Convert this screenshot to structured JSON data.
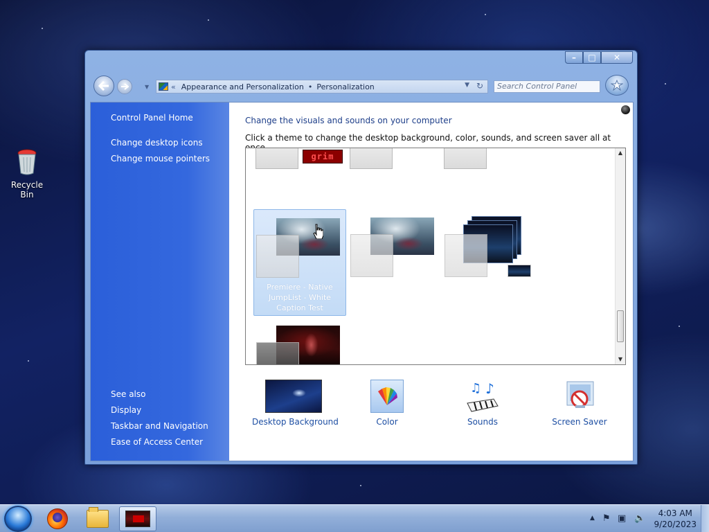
{
  "desktop": {
    "recycle_bin_label": "Recycle Bin"
  },
  "window": {
    "caption_buttons": {
      "minimize": "–",
      "maximize": "□",
      "close": "✕"
    },
    "address": {
      "chevron": "«",
      "crumb1": "Appearance and Personalization",
      "separator": "•",
      "crumb2": "Personalization"
    },
    "search": {
      "placeholder": "Search Control Panel"
    }
  },
  "sidebar": {
    "top_links": [
      "Control Panel Home",
      "Change desktop icons",
      "Change mouse pointers"
    ],
    "see_also_title": "See also",
    "see_also_links": [
      "Display",
      "Taskbar and Navigation",
      "Ease of Access Center"
    ]
  },
  "main": {
    "heading": "Change the visuals and sounds on your computer",
    "subheading": "Click a theme to change the desktop background, color, sounds, and screen saver all at once.",
    "themes": {
      "grim_logo_text": "grim",
      "selected_label": "Premiere - Native JumpList - White Caption Test"
    },
    "options": {
      "desktop_background": "Desktop Background",
      "color": "Color",
      "sounds": "Sounds",
      "screen_saver": "Screen Saver"
    }
  },
  "taskbar": {
    "clock_time": "4:03 AM",
    "clock_date": "9/20/2023",
    "icons": [
      "start-orb",
      "firefox-icon",
      "file-explorer-icon",
      "personalization-app-icon"
    ],
    "tray_icons": [
      "show-hidden-icons",
      "action-center-flag-icon",
      "network-icon",
      "volume-icon"
    ]
  },
  "colors": {
    "sidebar_blue": "#2b5fd9",
    "link_blue": "#1e4fa3",
    "selection_blue": "#c3dbf6"
  }
}
